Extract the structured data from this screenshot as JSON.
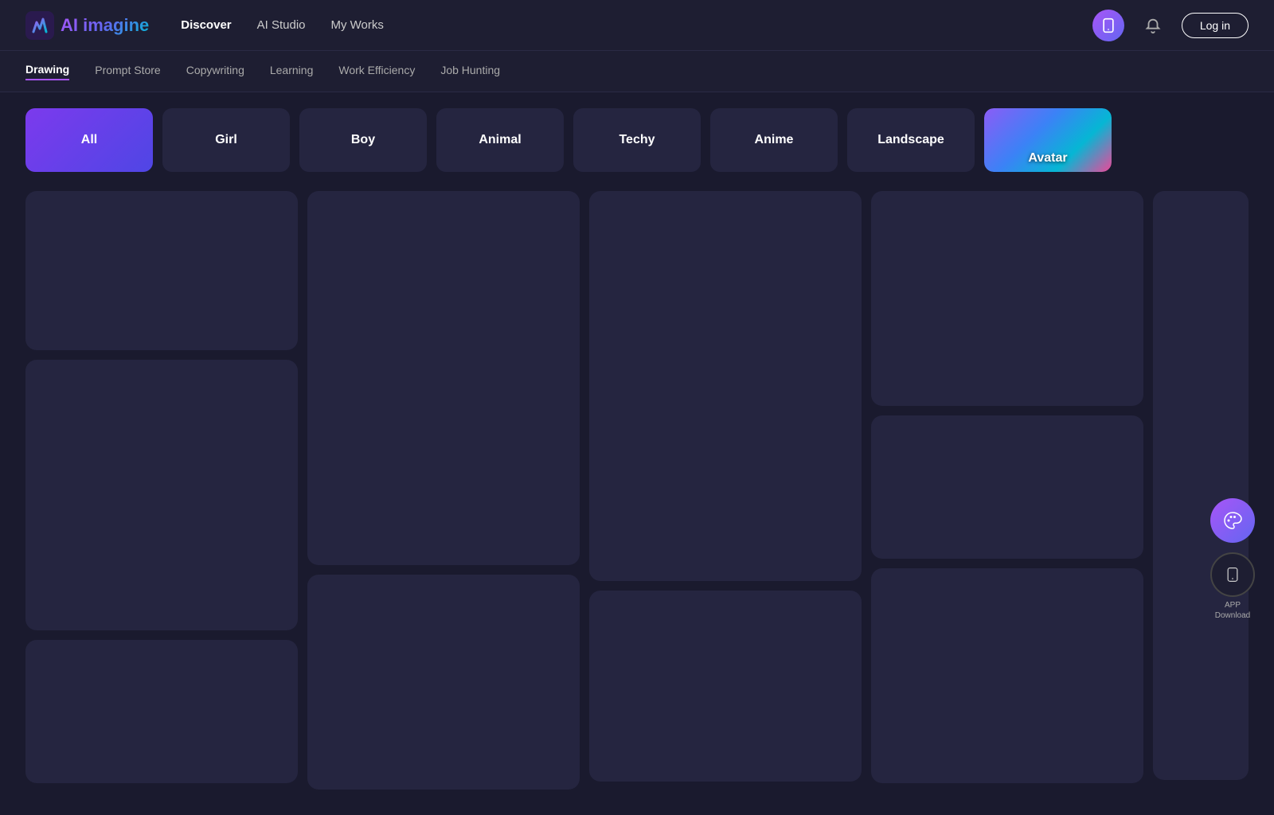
{
  "header": {
    "logo_text": "AI imagine",
    "nav": {
      "discover": "Discover",
      "ai_studio": "AI Studio",
      "my_works": "My Works"
    },
    "login_label": "Log in"
  },
  "sub_nav": {
    "items": [
      {
        "id": "drawing",
        "label": "Drawing",
        "active": true
      },
      {
        "id": "prompt_store",
        "label": "Prompt Store",
        "active": false
      },
      {
        "id": "copywriting",
        "label": "Copywriting",
        "active": false
      },
      {
        "id": "learning",
        "label": "Learning",
        "active": false
      },
      {
        "id": "work_efficiency",
        "label": "Work Efficiency",
        "active": false
      },
      {
        "id": "job_hunting",
        "label": "Job Hunting",
        "active": false
      }
    ]
  },
  "categories": [
    {
      "id": "all",
      "label": "All",
      "active": true
    },
    {
      "id": "girl",
      "label": "Girl",
      "active": false
    },
    {
      "id": "boy",
      "label": "Boy",
      "active": false
    },
    {
      "id": "animal",
      "label": "Animal",
      "active": false
    },
    {
      "id": "techy",
      "label": "Techy",
      "active": false
    },
    {
      "id": "anime",
      "label": "Anime",
      "active": false
    },
    {
      "id": "landscape",
      "label": "Landscape",
      "active": false
    },
    {
      "id": "avatar",
      "label": "Avatar",
      "active": false
    }
  ],
  "floating": {
    "app_download_line1": "APP",
    "app_download_line2": "Download"
  },
  "grid_placeholder_color": "#252540"
}
